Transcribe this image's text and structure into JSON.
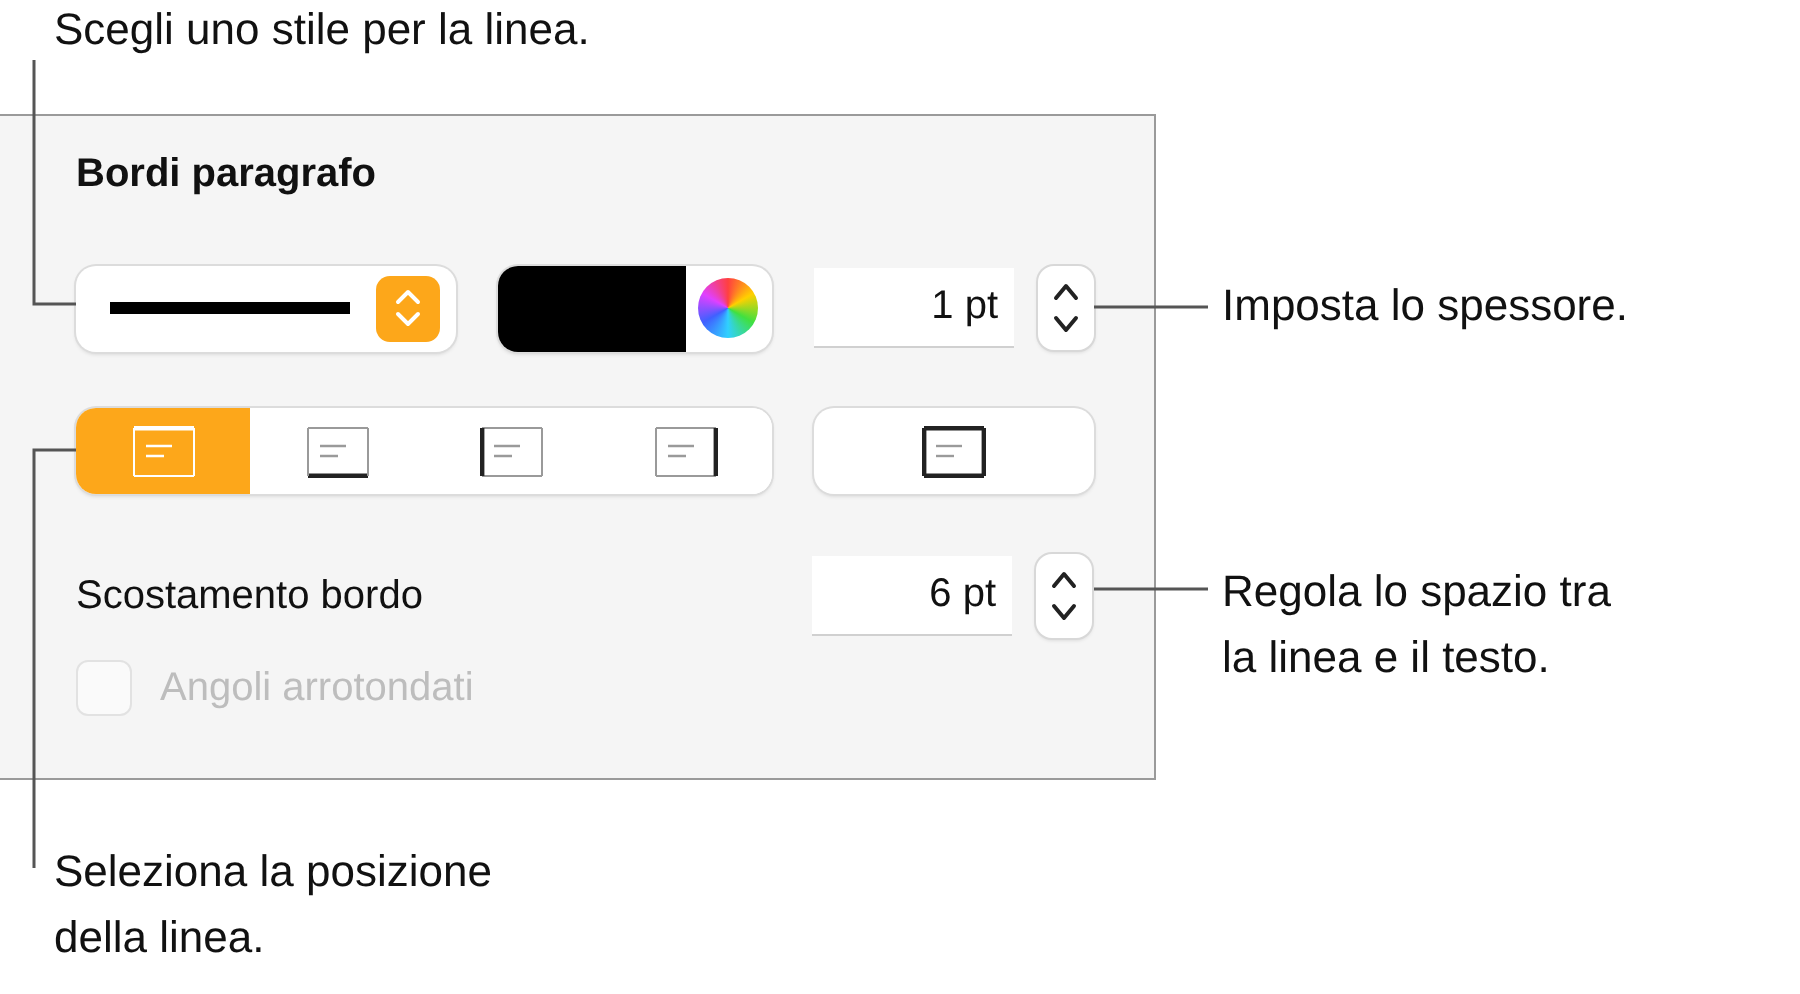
{
  "callouts": [
    {
      "lines": [
        "Scegli uno stile per la linea."
      ]
    },
    {
      "lines": [
        "Imposta lo spessore."
      ]
    },
    {
      "lines": [
        "Regola lo spazio tra",
        "la linea e il testo."
      ]
    },
    {
      "lines": [
        "Seleziona la posizione",
        "della linea."
      ]
    }
  ],
  "panel": {
    "title": "Bordi paragrafo",
    "color_well": {
      "color": "#000000"
    },
    "thickness": {
      "value": "1 pt"
    },
    "positions": [
      {
        "kind": "top",
        "selected": true
      },
      {
        "kind": "bottom",
        "selected": false
      },
      {
        "kind": "left",
        "selected": false
      },
      {
        "kind": "right",
        "selected": false
      }
    ],
    "outline_button": {
      "kind": "box",
      "selected": false
    },
    "offset": {
      "label": "Scostamento bordo",
      "value": "6 pt"
    },
    "rounded_corners": {
      "label": "Angoli arrotondati",
      "checked": false,
      "disabled": true
    }
  }
}
